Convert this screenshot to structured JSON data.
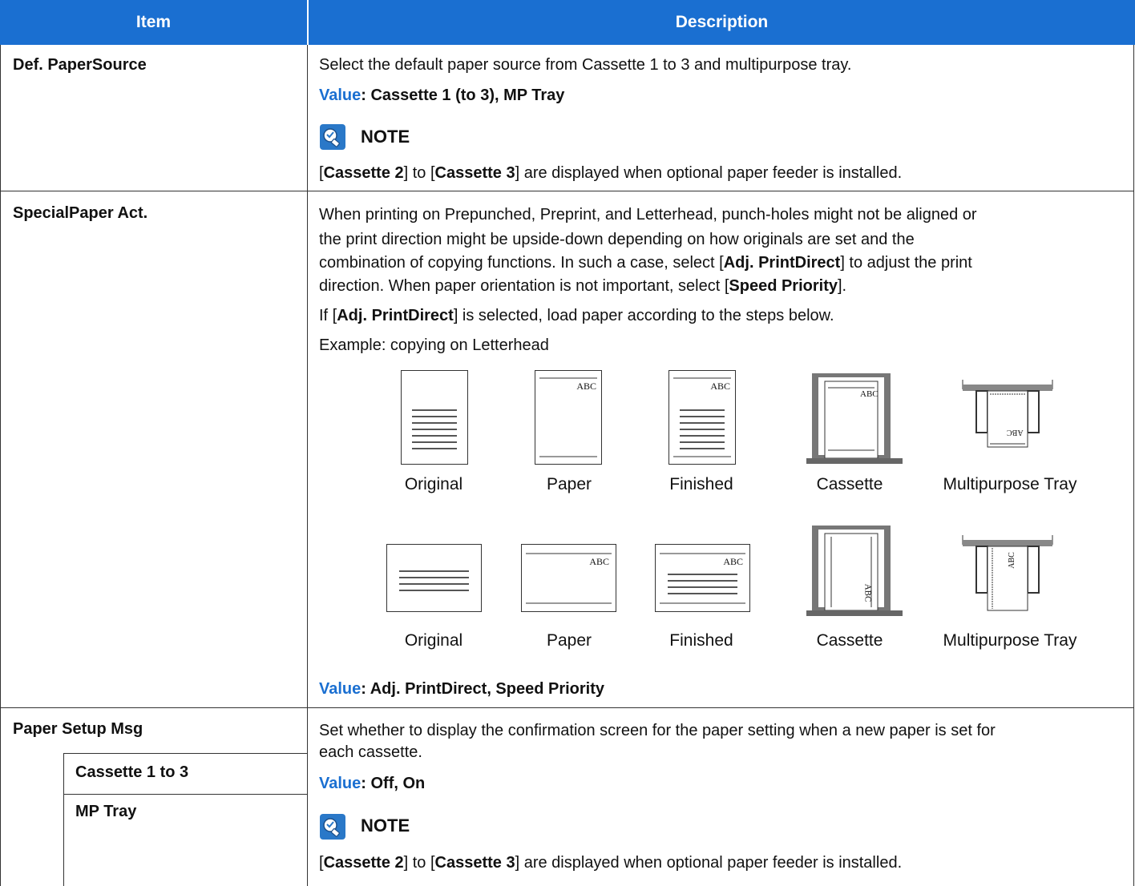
{
  "header": {
    "item": "Item",
    "description": "Description"
  },
  "rows": {
    "def_paper_source": {
      "label": "Def. PaperSource",
      "desc": "Select the default paper source from Cassette 1 to 3 and multipurpose tray.",
      "value_label": "Value",
      "value_text": ": Cassette 1 (to 3), MP Tray",
      "note_title": "NOTE",
      "note": {
        "p1": "[",
        "b1": "Cassette 2",
        "p2": "] to [",
        "b2": "Cassette 3",
        "p3": "] are displayed when optional paper feeder is installed."
      }
    },
    "special_paper": {
      "label": "SpecialPaper Act.",
      "line1": "When printing on Prepunched, Preprint, and Letterhead, punch-holes might not be aligned or",
      "line2": "the print direction might be upside-down depending on how originals are set and the",
      "line3a": "combination of copying functions. In such a case, select [",
      "line3b": "Adj. PrintDirect",
      "line3c": "] to adjust the print",
      "line4a": "direction. When paper orientation is not important, select [",
      "line4b": "Speed Priority",
      "line4c": "].",
      "line5a": "If [",
      "line5b": "Adj. PrintDirect",
      "line5c": "] is selected, load paper according to the steps below.",
      "example": "Example: copying on Letterhead",
      "captions_row1": [
        "Original",
        "Paper",
        "Finished",
        "Cassette",
        "Multipurpose Tray"
      ],
      "captions_row2": [
        "Original",
        "Paper",
        "Finished",
        "Cassette",
        "Multipurpose Tray"
      ],
      "abc": "ABC",
      "value_label": "Value",
      "value_text": ": Adj. PrintDirect, Speed Priority"
    },
    "paper_setup_msg": {
      "label": "Paper Setup Msg",
      "sub1": "Cassette 1 to 3",
      "sub2": "MP Tray",
      "line1": "Set whether to display the confirmation screen for the paper setting when a new paper is set for",
      "line2": "each cassette.",
      "value_label": "Value",
      "value_text": ": Off, On",
      "note_title": "NOTE",
      "note": {
        "p1": "[",
        "b1": "Cassette 2",
        "p2": "] to [",
        "b2": "Cassette 3",
        "p3": "] are displayed when optional paper feeder is installed."
      }
    }
  },
  "colors": {
    "header_bg": "#1a6fd1",
    "accent": "#1a6fd1",
    "border": "#333333"
  }
}
